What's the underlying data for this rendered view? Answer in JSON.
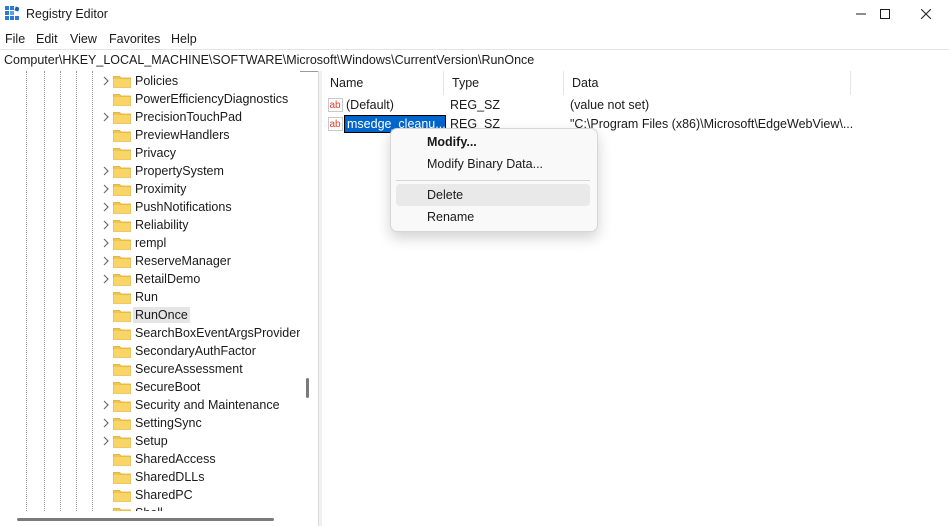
{
  "window": {
    "title": "Registry Editor",
    "controls": [
      "minimize",
      "maximize",
      "close"
    ]
  },
  "menu": {
    "items": [
      "File",
      "Edit",
      "View",
      "Favorites",
      "Help"
    ]
  },
  "address": {
    "path": "Computer\\HKEY_LOCAL_MACHINE\\SOFTWARE\\Microsoft\\Windows\\CurrentVersion\\RunOnce"
  },
  "tree": {
    "items": [
      {
        "label": "Policies",
        "expandable": true
      },
      {
        "label": "PowerEfficiencyDiagnostics",
        "expandable": false
      },
      {
        "label": "PrecisionTouchPad",
        "expandable": true
      },
      {
        "label": "PreviewHandlers",
        "expandable": false
      },
      {
        "label": "Privacy",
        "expandable": false
      },
      {
        "label": "PropertySystem",
        "expandable": true
      },
      {
        "label": "Proximity",
        "expandable": true
      },
      {
        "label": "PushNotifications",
        "expandable": true
      },
      {
        "label": "Reliability",
        "expandable": true
      },
      {
        "label": "rempl",
        "expandable": true
      },
      {
        "label": "ReserveManager",
        "expandable": true
      },
      {
        "label": "RetailDemo",
        "expandable": true
      },
      {
        "label": "Run",
        "expandable": false
      },
      {
        "label": "RunOnce",
        "expandable": false,
        "selected": true
      },
      {
        "label": "SearchBoxEventArgsProvider",
        "expandable": false
      },
      {
        "label": "SecondaryAuthFactor",
        "expandable": false
      },
      {
        "label": "SecureAssessment",
        "expandable": false
      },
      {
        "label": "SecureBoot",
        "expandable": false
      },
      {
        "label": "Security and Maintenance",
        "expandable": true
      },
      {
        "label": "SettingSync",
        "expandable": true
      },
      {
        "label": "Setup",
        "expandable": true
      },
      {
        "label": "SharedAccess",
        "expandable": false
      },
      {
        "label": "SharedDLLs",
        "expandable": false
      },
      {
        "label": "SharedPC",
        "expandable": false
      },
      {
        "label": "Shell",
        "expandable": false
      }
    ]
  },
  "list": {
    "columns": [
      "Name",
      "Type",
      "Data"
    ],
    "rows": [
      {
        "name": "(Default)",
        "type": "REG_SZ",
        "data": "(value not set)"
      },
      {
        "name": "msedge_cleanu...",
        "type": "REG_SZ",
        "data": "\"C:\\Program Files (x86)\\Microsoft\\EdgeWebView\\..."
      }
    ]
  },
  "context_menu": {
    "items": [
      "Modify...",
      "Modify Binary Data...",
      "Delete",
      "Rename"
    ],
    "hovered": "Delete"
  },
  "colors": {
    "selection": "#0066cc",
    "folder": "#f2c648",
    "ab_icon": "#d9412b"
  }
}
